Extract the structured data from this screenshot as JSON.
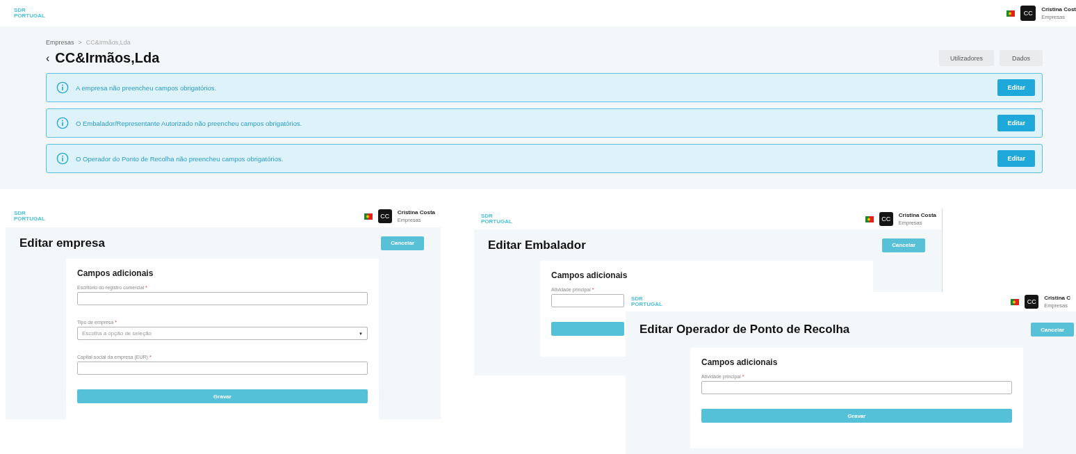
{
  "screens": [
    {
      "kind": "company",
      "logo": [
        "SDR",
        "PORTUGAL"
      ],
      "user": {
        "initials": "CC",
        "name": "Cristina Cost",
        "role": "Empresas"
      },
      "breadcrumb": {
        "items": [
          "Empresas",
          "CC&Irmãos,Lda"
        ],
        "separator": ">"
      },
      "back": "‹",
      "title": "CC&Irmãos,Lda",
      "buttons": [
        "Utilizadores",
        "Dados"
      ],
      "alerts": [
        {
          "message": "A empresa não preencheu campos obrigatórios.",
          "action": "Editar"
        },
        {
          "message": "O Embalador/Representante Autorizado não preencheu campos obrigatórios.",
          "action": "Editar"
        },
        {
          "message": "O Operador do Ponto de Recolha não preencheu campos obrigatórios.",
          "action": "Editar"
        }
      ]
    },
    {
      "kind": "form",
      "logo": [
        "SDR",
        "PORTUGAL"
      ],
      "user": {
        "initials": "CC",
        "name": "Cristina Costa",
        "role": "Empresas"
      },
      "title": "Editar empresa",
      "cancel": "Cancelar",
      "section": "Campos adicionais",
      "fields": [
        {
          "kind": "text",
          "label": "Escritório do registro comercial",
          "required_mark": "*"
        },
        {
          "kind": "select",
          "label": "Tipo de empresa",
          "required_mark": "*",
          "placeholder": "Escolha a opção de seleção",
          "caret": "▼"
        },
        {
          "kind": "text",
          "label": "Capital social da empresa (EUR)",
          "required_mark": "*"
        }
      ],
      "submit": "Gravar"
    },
    {
      "kind": "form",
      "logo": [
        "SDR",
        "PORTUGAL"
      ],
      "user": {
        "initials": "CC",
        "name": "Cristina Costa",
        "role": "Empresas"
      },
      "title": "Editar Embalador",
      "cancel": "Cancelar",
      "section": "Campos adicionais",
      "fields": [
        {
          "kind": "text",
          "label": "Atividade principal",
          "required_mark": "*"
        }
      ]
    },
    {
      "kind": "form",
      "logo": [
        "SDR",
        "PORTUGAL"
      ],
      "user": {
        "initials": "CC",
        "name": "Cristina C",
        "role": "Empresas"
      },
      "title": "Editar Operador de Ponto de Recolha",
      "cancel": "Cancelar",
      "section": "Campos adicionais",
      "fields": [
        {
          "kind": "text",
          "label": "Atividade principal",
          "required_mark": "*"
        }
      ],
      "submit": "Gravar"
    }
  ]
}
